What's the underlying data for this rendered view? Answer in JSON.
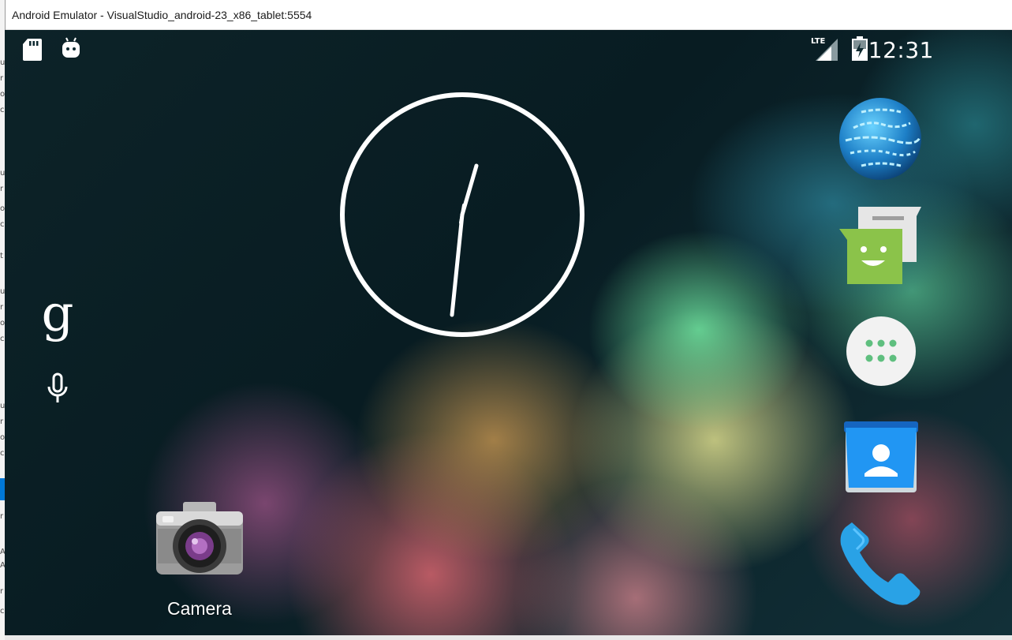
{
  "window": {
    "title": "Android Emulator - VisualStudio_android-23_x86_tablet:5554"
  },
  "left_edge_chars": [
    "u",
    "r",
    "o",
    "c",
    "u",
    "r",
    "o",
    "c",
    "t",
    "u",
    "r",
    "o",
    "c",
    "u",
    "r",
    "o",
    "c",
    "r",
    "A",
    "A",
    "r",
    "c"
  ],
  "status_bar": {
    "left_icons": [
      "sd-card-icon",
      "android-debug-icon"
    ],
    "network_label": "LTE",
    "time": "12:31"
  },
  "home": {
    "analog_clock": {
      "hour": 12,
      "minute": 31
    },
    "search_icons": [
      "google-search-icon",
      "voice-search-icon"
    ],
    "shortcuts": [
      {
        "icon": "camera-icon",
        "label": "Camera"
      }
    ],
    "dock": [
      "browser-icon",
      "messaging-icon",
      "app-drawer-icon",
      "contacts-icon",
      "phone-icon"
    ]
  },
  "colors": {
    "messaging_green": "#8bc34a",
    "phone_blue": "#29a2e6",
    "contacts_blue": "#1e88e5"
  }
}
